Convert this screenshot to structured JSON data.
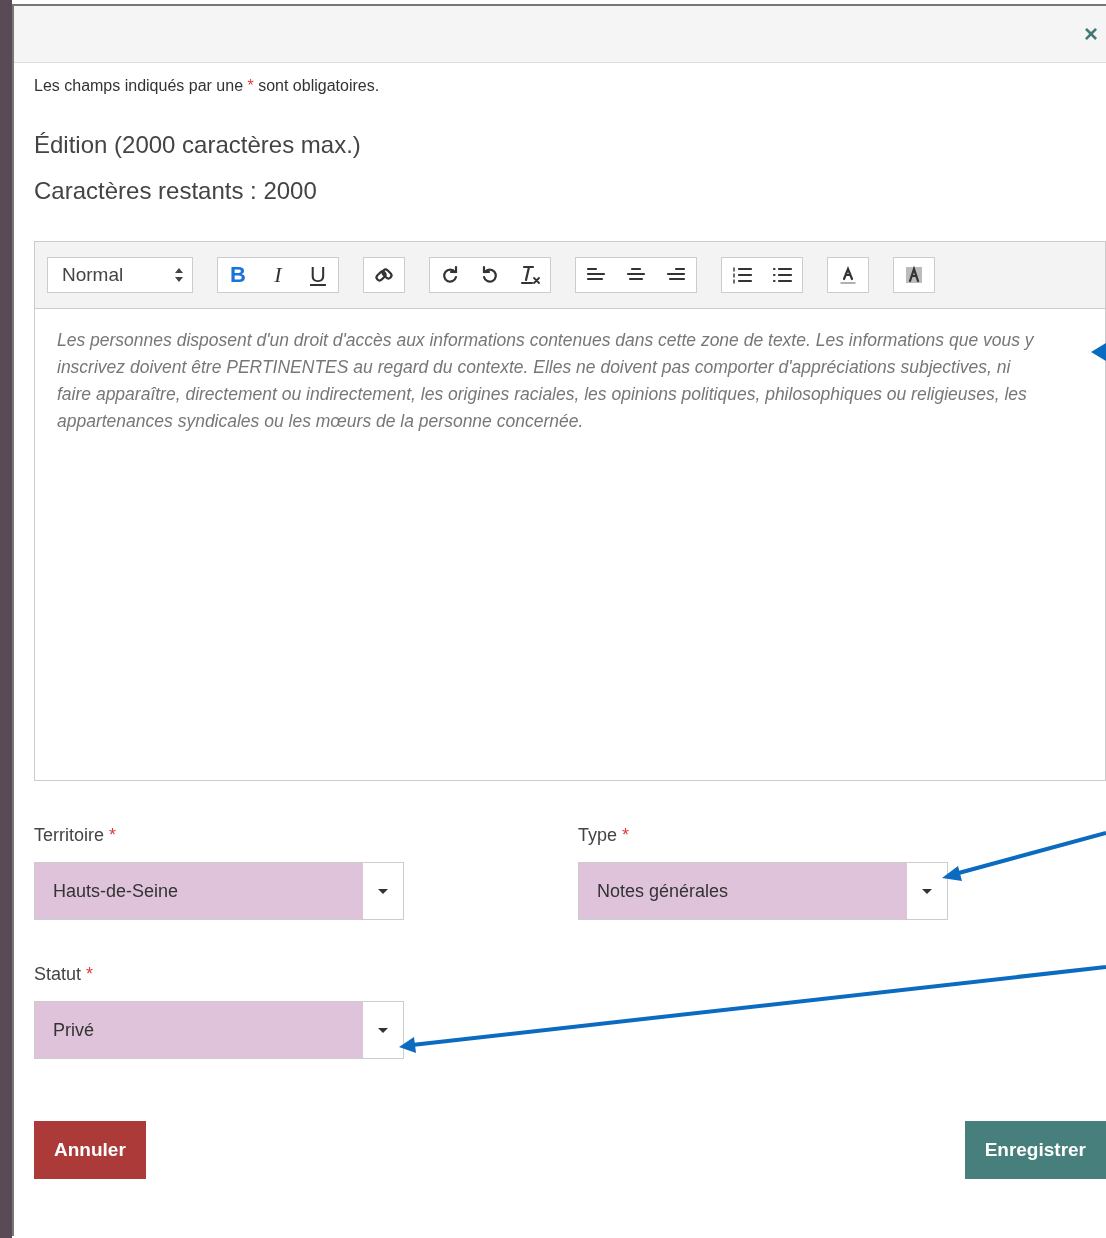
{
  "dialog": {
    "close": "×"
  },
  "required_note": {
    "before": "Les champs indiqués par une",
    "mark": "*",
    "after": "sont obligatoires."
  },
  "heading": "Édition (2000 caractères max.)",
  "remaining": "Caractères restants : 2000",
  "editor": {
    "format": "Normal",
    "letter_buttons": [
      {
        "kind": "bold",
        "text": "B",
        "selected": true
      },
      {
        "kind": "italic",
        "text": "I",
        "selected": false
      },
      {
        "kind": "underline",
        "text": "U",
        "selected": false
      }
    ],
    "placeholder": "Les personnes disposent d'un droit d'accès aux informations contenues dans cette zone de texte. Les informations que vous y inscrivez doivent être PERTINENTES au regard du contexte. Elles ne doivent pas comporter d'appréciations subjectives, ni faire apparaître, directement ou indirectement, les origines raciales, les opinions politiques, philosophiques ou religieuses, les appartenances syndicales ou les mœurs de la personne concernée."
  },
  "fields": [
    {
      "label": "Territoire",
      "required_mark": "*",
      "value": "Hauts-de-Seine"
    },
    {
      "label": "Type",
      "required_mark": "*",
      "value": "Notes générales"
    },
    {
      "label": "Statut",
      "required_mark": "*",
      "value": "Privé"
    }
  ],
  "buttons": [
    {
      "kind": "cancel",
      "label": "Annuler"
    },
    {
      "kind": "save",
      "label": "Enregistrer"
    }
  ]
}
